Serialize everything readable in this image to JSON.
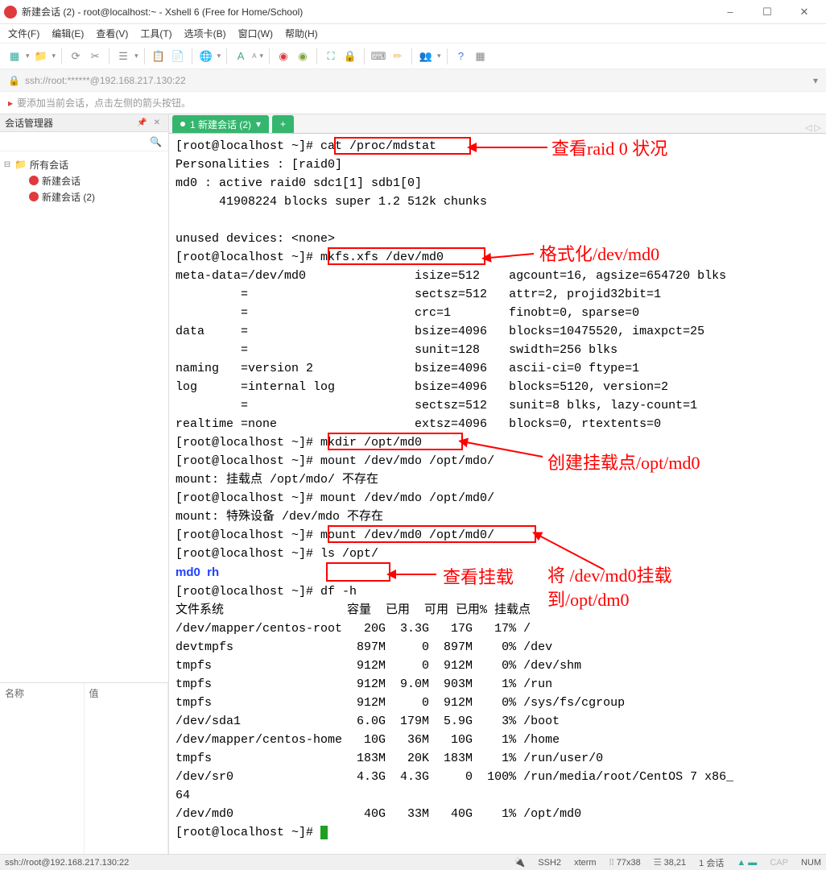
{
  "window": {
    "title": "新建会话 (2) - root@localhost:~ - Xshell 6 (Free for Home/School)"
  },
  "menus": [
    "文件(F)",
    "编辑(E)",
    "查看(V)",
    "工具(T)",
    "选项卡(B)",
    "窗口(W)",
    "帮助(H)"
  ],
  "address": "ssh://root:******@192.168.217.130:22",
  "hint": "要添加当前会话，点击左侧的箭头按钮。",
  "panel_title": "会话管理器",
  "tree": {
    "root": "所有会话",
    "items": [
      "新建会话",
      "新建会话 (2)"
    ]
  },
  "prop_cols": [
    "名称",
    "值"
  ],
  "tab": {
    "label": "1 新建会话 (2)",
    "add": "+",
    "tabarrows": "◁ ▷"
  },
  "term": {
    "lines": [
      "[root@localhost ~]# cat /proc/mdstat",
      "Personalities : [raid0]",
      "md0 : active raid0 sdc1[1] sdb1[0]",
      "      41908224 blocks super 1.2 512k chunks",
      "",
      "unused devices: <none>",
      "[root@localhost ~]# mkfs.xfs /dev/md0",
      "meta-data=/dev/md0               isize=512    agcount=16, agsize=654720 blks",
      "         =                       sectsz=512   attr=2, projid32bit=1",
      "         =                       crc=1        finobt=0, sparse=0",
      "data     =                       bsize=4096   blocks=10475520, imaxpct=25",
      "         =                       sunit=128    swidth=256 blks",
      "naming   =version 2              bsize=4096   ascii-ci=0 ftype=1",
      "log      =internal log           bsize=4096   blocks=5120, version=2",
      "         =                       sectsz=512   sunit=8 blks, lazy-count=1",
      "realtime =none                   extsz=4096   blocks=0, rtextents=0",
      "[root@localhost ~]# mkdir /opt/md0",
      "[root@localhost ~]# mount /dev/mdo /opt/mdo/",
      "mount: 挂载点 /opt/mdo/ 不存在",
      "[root@localhost ~]# mount /dev/mdo /opt/md0/",
      "mount: 特殊设备 /dev/mdo 不存在",
      "[root@localhost ~]# mount /dev/md0 /opt/md0/",
      "[root@localhost ~]# ls /opt/"
    ],
    "ls_out": "md0  rh",
    "df_cmd": "[root@localhost ~]# df -h",
    "df_head": "文件系统                 容量  已用  可用 已用% 挂载点",
    "df_rows": [
      "/dev/mapper/centos-root   20G  3.3G   17G   17% /",
      "devtmpfs                 897M     0  897M    0% /dev",
      "tmpfs                    912M     0  912M    0% /dev/shm",
      "tmpfs                    912M  9.0M  903M    1% /run",
      "tmpfs                    912M     0  912M    0% /sys/fs/cgroup",
      "/dev/sda1                6.0G  179M  5.9G    3% /boot",
      "/dev/mapper/centos-home   10G   36M   10G    1% /home",
      "tmpfs                    183M   20K  183M    1% /run/user/0",
      "/dev/sr0                 4.3G  4.3G     0  100% /run/media/root/CentOS 7 x86_",
      "64",
      "/dev/md0                  40G   33M   40G    1% /opt/md0",
      "[root@localhost ~]# "
    ]
  },
  "annotations": {
    "a1": "查看raid 0 状况",
    "a2": "格式化/dev/md0",
    "a3": "创建挂载点/opt/md0",
    "a4_l1": "将 /dev/md0挂载",
    "a4_l2": "到/opt/dm0",
    "a5": "查看挂载"
  },
  "status": {
    "left": "ssh://root@192.168.217.130:22",
    "ssh": "SSH2",
    "term": "xterm",
    "size": "77x38",
    "cur": "38,21",
    "sess": "1 会话",
    "cap": "CAP",
    "num": "NUM"
  },
  "icons": {
    "min": "–",
    "max": "☐",
    "close": "✕",
    "search": "🔍",
    "pin": "📌",
    "x": "✕",
    "folder": "📁",
    "dd": "▾"
  }
}
